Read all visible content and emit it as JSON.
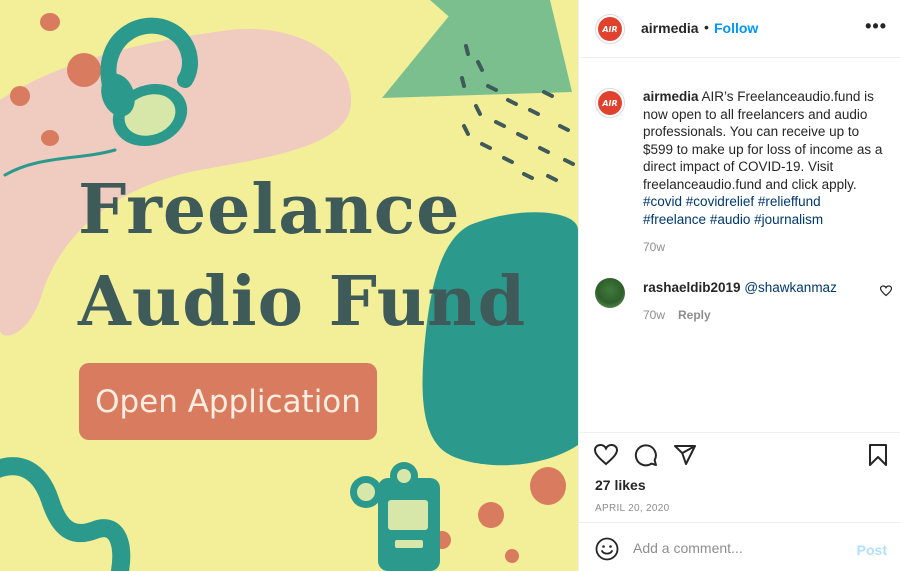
{
  "colors": {
    "image_background": "#f3ee98",
    "headline": "#3e5a59",
    "button_background": "#d97b5f",
    "teal_shape": "#2b9a8c",
    "pink_shape": "#efcbc0",
    "green_triangle": "#7bbf8e",
    "link": "#00376b",
    "follow": "#0095f6",
    "post_disabled": "#b2dffc"
  },
  "image": {
    "headline_line1": "Freelance",
    "headline_line2": "Audio Fund",
    "button_label": "Open Application"
  },
  "header": {
    "avatar_text": "AIR",
    "username": "airmedia",
    "dot": "•",
    "follow_label": "Follow",
    "more_icon": "more-options-icon"
  },
  "caption": {
    "avatar_text": "AIR",
    "username": "airmedia",
    "text": "AIR’s Freelanceaudio.fund is now open to all freelancers and audio professionals. You can receive up to $599 to make up for loss of income as a direct impact of COVID-19. Visit freelanceaudio.fund and click apply.",
    "hashtags": [
      "#covid",
      "#covidrelief",
      "#relieffund",
      "#freelance",
      "#audio",
      "#journalism"
    ],
    "time": "70w"
  },
  "comments": [
    {
      "username": "rashaeldib2019",
      "mention": "@shawkanmaz",
      "time": "70w",
      "reply_label": "Reply"
    }
  ],
  "actions": {
    "like_icon": "heart-icon",
    "comment_icon": "comment-icon",
    "share_icon": "share-icon",
    "save_icon": "bookmark-icon",
    "likes": "27 likes",
    "date": "APRIL 20, 2020"
  },
  "add_comment": {
    "emoji_icon": "emoji-icon",
    "placeholder": "Add a comment...",
    "post_label": "Post"
  }
}
